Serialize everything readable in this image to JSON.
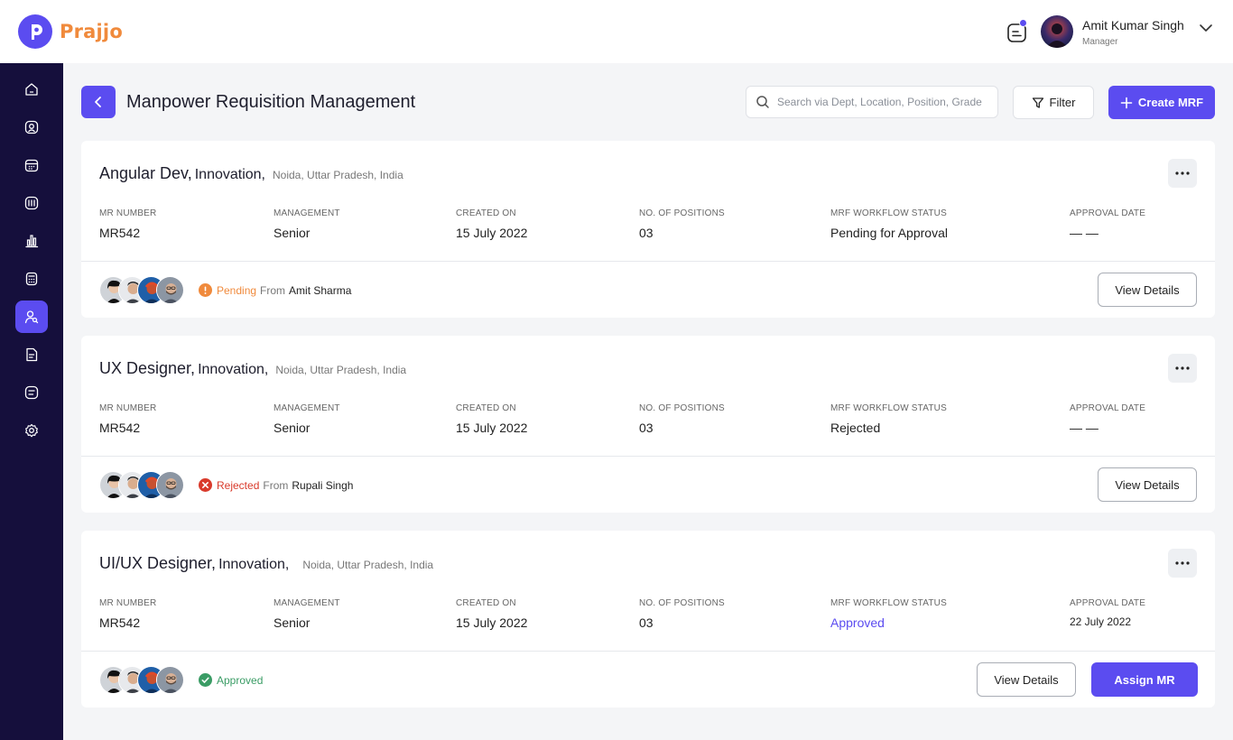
{
  "brand": {
    "name": "Prajjo",
    "primary_color": "#5b4cf0",
    "accent_color": "#f08a3c",
    "sidebar_color": "#150f3c"
  },
  "user": {
    "name": "Amit Kumar Singh",
    "role": "Manager"
  },
  "sidebar": {
    "items": [
      {
        "icon": "home-icon"
      },
      {
        "icon": "user-icon"
      },
      {
        "icon": "calendar-icon"
      },
      {
        "icon": "book-icon"
      },
      {
        "icon": "chart-icon"
      },
      {
        "icon": "calculator-icon"
      },
      {
        "icon": "user-search-icon",
        "active": true
      },
      {
        "icon": "document-icon"
      },
      {
        "icon": "list-icon"
      },
      {
        "icon": "settings-icon"
      }
    ]
  },
  "page": {
    "title": "Manpower Requisition Management",
    "search_placeholder": "Search via Dept, Location, Position, Grade",
    "filter_label": "Filter",
    "create_label": "Create MRF"
  },
  "labels": {
    "mr_number": "MR NUMBER",
    "management": "MANAGEMENT",
    "created_on": "CREATED ON",
    "positions": "NO. OF POSITIONS",
    "workflow_status": "MRF WORKFLOW STATUS",
    "approval_date": "APPROVAL DATE",
    "from": "From",
    "view_details": "View Details",
    "assign_mr": "Assign MR"
  },
  "cards": [
    {
      "title": "Angular Dev,",
      "dept": "Innovation,",
      "location": "Noida, Uttar Pradesh, India",
      "mr_number": "MR542",
      "management": "Senior",
      "created_on": "15 July 2022",
      "positions": "03",
      "workflow_status": "Pending for Approval",
      "approval_date": "— —",
      "status": "Pending",
      "status_person": "Amit Sharma"
    },
    {
      "title": "UX Designer,",
      "dept": "Innovation,",
      "location": "Noida, Uttar Pradesh, India",
      "mr_number": "MR542",
      "management": "Senior",
      "created_on": "15 July 2022",
      "positions": "03",
      "workflow_status": "Rejected",
      "approval_date": "— —",
      "status": "Rejected",
      "status_person": "Rupali Singh"
    },
    {
      "title": "UI/UX Designer,",
      "dept": "Innovation,",
      "location": "Noida, Uttar Pradesh, India",
      "mr_number": "MR542",
      "management": "Senior",
      "created_on": "15 July 2022",
      "positions": "03",
      "workflow_status": "Approved",
      "approval_date": "22 July 2022",
      "status": "Approved",
      "status_person": ""
    }
  ]
}
